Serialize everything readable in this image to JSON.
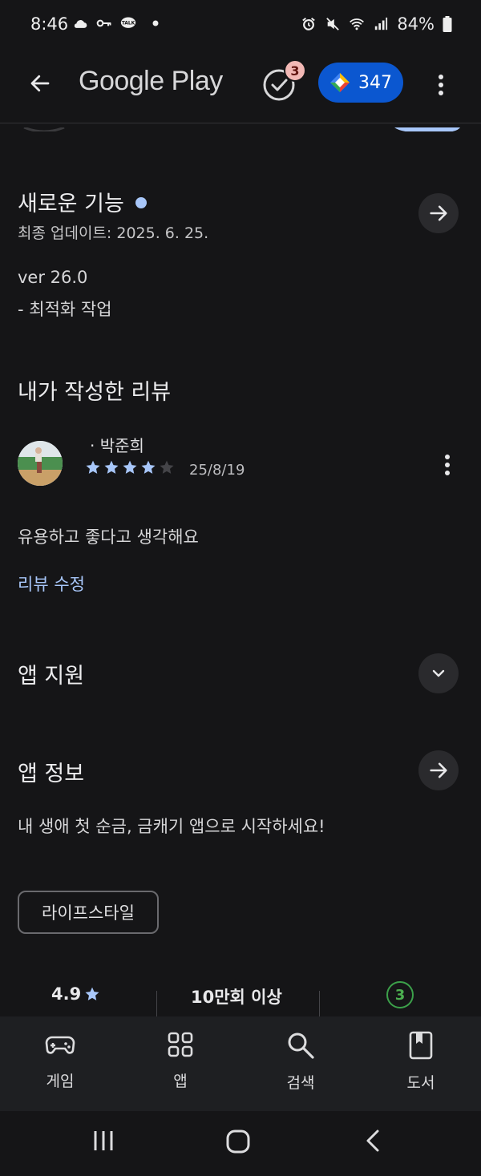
{
  "status_bar": {
    "time": "8:46",
    "battery": "84%",
    "icons_left": [
      "cloud-icon",
      "key-icon",
      "talk-icon",
      "dot-icon"
    ],
    "icons_right": [
      "alarm-icon",
      "mute-icon",
      "wifi-icon",
      "signal-icon",
      "battery-icon"
    ]
  },
  "app_bar": {
    "brand": "Google Play",
    "tasks_badge": "3",
    "points": "347"
  },
  "whats_new": {
    "title": "새로운 기능",
    "updated": "최종 업데이트: 2025. 6. 25.",
    "version": "ver 26.0",
    "changes": "- 최적화 작업"
  },
  "my_review": {
    "title": "내가 작성한 리뷰",
    "reviewer": "· 박준희",
    "rating": 4,
    "max_rating": 5,
    "date": "25/8/19",
    "text": "유용하고 좋다고 생각해요",
    "edit_label": "리뷰 수정"
  },
  "app_support": {
    "title": "앱 지원"
  },
  "app_info": {
    "title": "앱 정보",
    "description": "내 생애 첫 순금, 금캐기 앱으로 시작하세요!",
    "category": "라이프스타일"
  },
  "stats": {
    "rating": "4.9",
    "installs": "10만회 이상",
    "age": "3"
  },
  "bottom_nav": {
    "items": [
      {
        "label": "게임",
        "icon": "gamepad-icon"
      },
      {
        "label": "앱",
        "icon": "apps-grid-icon"
      },
      {
        "label": "검색",
        "icon": "search-icon"
      },
      {
        "label": "도서",
        "icon": "book-icon"
      }
    ]
  },
  "colors": {
    "background": "#151517",
    "accent_blue": "#0b57d0",
    "link_blue": "#a8c7fa",
    "age_green": "#3ca04a"
  }
}
